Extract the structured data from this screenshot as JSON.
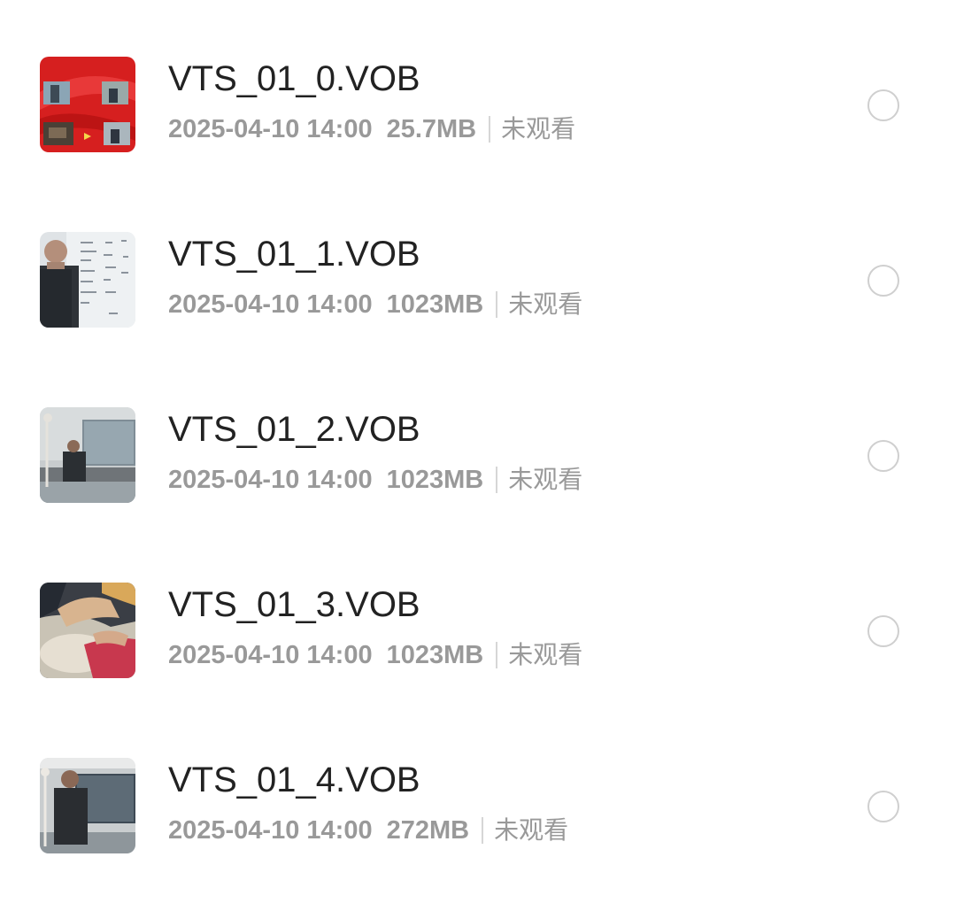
{
  "files": [
    {
      "name": "VTS_01_0.VOB",
      "date": "2025-04-10 14:00",
      "size": "25.7MB",
      "status": "未观看",
      "thumb": "thumbnail-menu-red"
    },
    {
      "name": "VTS_01_1.VOB",
      "date": "2025-04-10 14:00",
      "size": "1023MB",
      "status": "未观看",
      "thumb": "thumbnail-whiteboard-lecturer"
    },
    {
      "name": "VTS_01_2.VOB",
      "date": "2025-04-10 14:00",
      "size": "1023MB",
      "status": "未观看",
      "thumb": "thumbnail-classroom"
    },
    {
      "name": "VTS_01_3.VOB",
      "date": "2025-04-10 14:00",
      "size": "1023MB",
      "status": "未观看",
      "thumb": "thumbnail-hands-closeup"
    },
    {
      "name": "VTS_01_4.VOB",
      "date": "2025-04-10 14:00",
      "size": "272MB",
      "status": "未观看",
      "thumb": "thumbnail-classroom-speaker"
    }
  ],
  "colors": {
    "title": "#222222",
    "meta": "#999999",
    "radio_border": "#cfcfcf"
  }
}
